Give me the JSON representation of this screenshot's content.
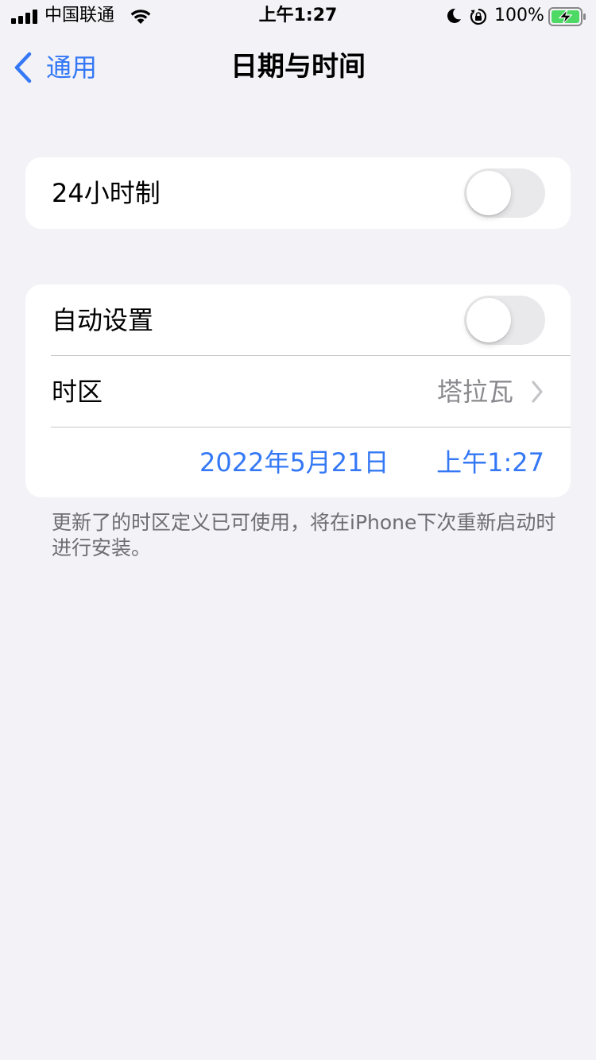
{
  "status_bar": {
    "carrier": "中国联通",
    "time": "上午1:27",
    "battery_percent": "100%",
    "icons": [
      "signal-icon",
      "wifi-icon",
      "moon-icon",
      "orientation-lock-icon",
      "battery-charging-icon"
    ]
  },
  "nav": {
    "back_label": "通用",
    "title": "日期与时间"
  },
  "group1": {
    "hour24_label": "24小时制",
    "hour24_on": false
  },
  "group2": {
    "auto_label": "自动设置",
    "auto_on": false,
    "timezone_label": "时区",
    "timezone_value": "塔拉瓦",
    "date": "2022年5月21日",
    "time": "上午1:27"
  },
  "footnote": "更新了的时区定义已可使用，将在iPhone下次重新启动时进行安装。",
  "colors": {
    "accent": "#3478f6",
    "background": "#f2f2f7",
    "switch_off": "#e9e9eb",
    "battery_charging": "#4cd964"
  }
}
